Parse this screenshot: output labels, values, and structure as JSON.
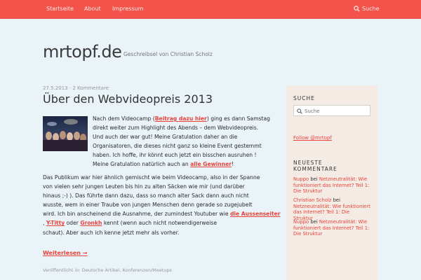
{
  "nav": {
    "items": [
      "Startseite",
      "About",
      "Impressum"
    ],
    "search_label": "Suche"
  },
  "site": {
    "title": "mrtopf.de",
    "description": "Geschreibsel von Christian Scholz"
  },
  "post": {
    "date": "27.5.2013",
    "comments": "2 Kommentare",
    "title": "Über den Webvideopreis 2013",
    "p1_lines": [
      [
        "Nach dem Videocamp (",
        "Beitrag dazu hier",
        ") ging es dann Samstag"
      ],
      [
        "direkt weiter zum Highlight des Abends – dem Webvideopreis."
      ],
      [
        "Und auch der war gut! Meine Gratulation daher an die"
      ],
      [
        "Organisatoren, die dieses nicht ganz so kleine Event gestemmt"
      ],
      [
        "haben. Ich hoffe, ihr könnt euch jetzt ein bisschen ausruhen !"
      ],
      [
        "Meine Gratulation natürlich auch an ",
        "alle Gewinner",
        "!"
      ]
    ],
    "p2_lines": [
      "Das Publikum war hier ähnlich gemischt wie beim Videocamp, also in der Spanne",
      "von vielen sehr jungen Leuten bis hin zu alten Säcken wie mir (und darüber",
      "hinaus ;-) ). Das führte dann dazu, dass so manch alter Sack dann auch nicht",
      "wusste, wem in einer Traube von jungen Menschen denn gerade so zugejubelt",
      "wird. Ich bin anscheinend die Ausnahme, der zumindest Youtuber wie",
      "die Aussenseiter",
      ", ",
      "Y-Titty",
      " oder ",
      "Gronkh",
      " kennt (wenn auch nicht notwendigerweise",
      "schaut). Aber auch ich kenne jetzt mehr als vorher."
    ],
    "read_more": "Weiterlesen →",
    "footer": "Veröffentlicht in: Deutsche Artikel, Konferenzen/Meetups"
  },
  "sidebar": {
    "search_heading": "SUCHE",
    "search_placeholder": "Suche",
    "follow": "Follow @mrtopf",
    "comments_heading_1": "NEUESTE",
    "comments_heading_2": "KOMMENTARE",
    "comments": [
      {
        "author": "Nuppo",
        "sep": " bei ",
        "post_lines": [
          "Netzneutralität: Wie",
          "funktioniert das Internet? Teil 1:",
          "Die Struktur"
        ]
      },
      {
        "author": "Christian Scholz",
        "sep": " bei ",
        "post_lines": [
          "Netzneutralität: Wie funktioniert",
          "das Internet? Teil 1: Die",
          "Struktur"
        ]
      },
      {
        "author": "Nuppo",
        "sep": " bei ",
        "post_lines": [
          "Netzneutralität: Wie",
          "funktioniert das Internet? Teil 1:",
          "Die Struktur"
        ]
      }
    ]
  },
  "colors": {
    "topbar": "#f2544b",
    "accent": "#e8433a",
    "background": "#e9f3f8",
    "sidebar": "#f4ebe4"
  }
}
